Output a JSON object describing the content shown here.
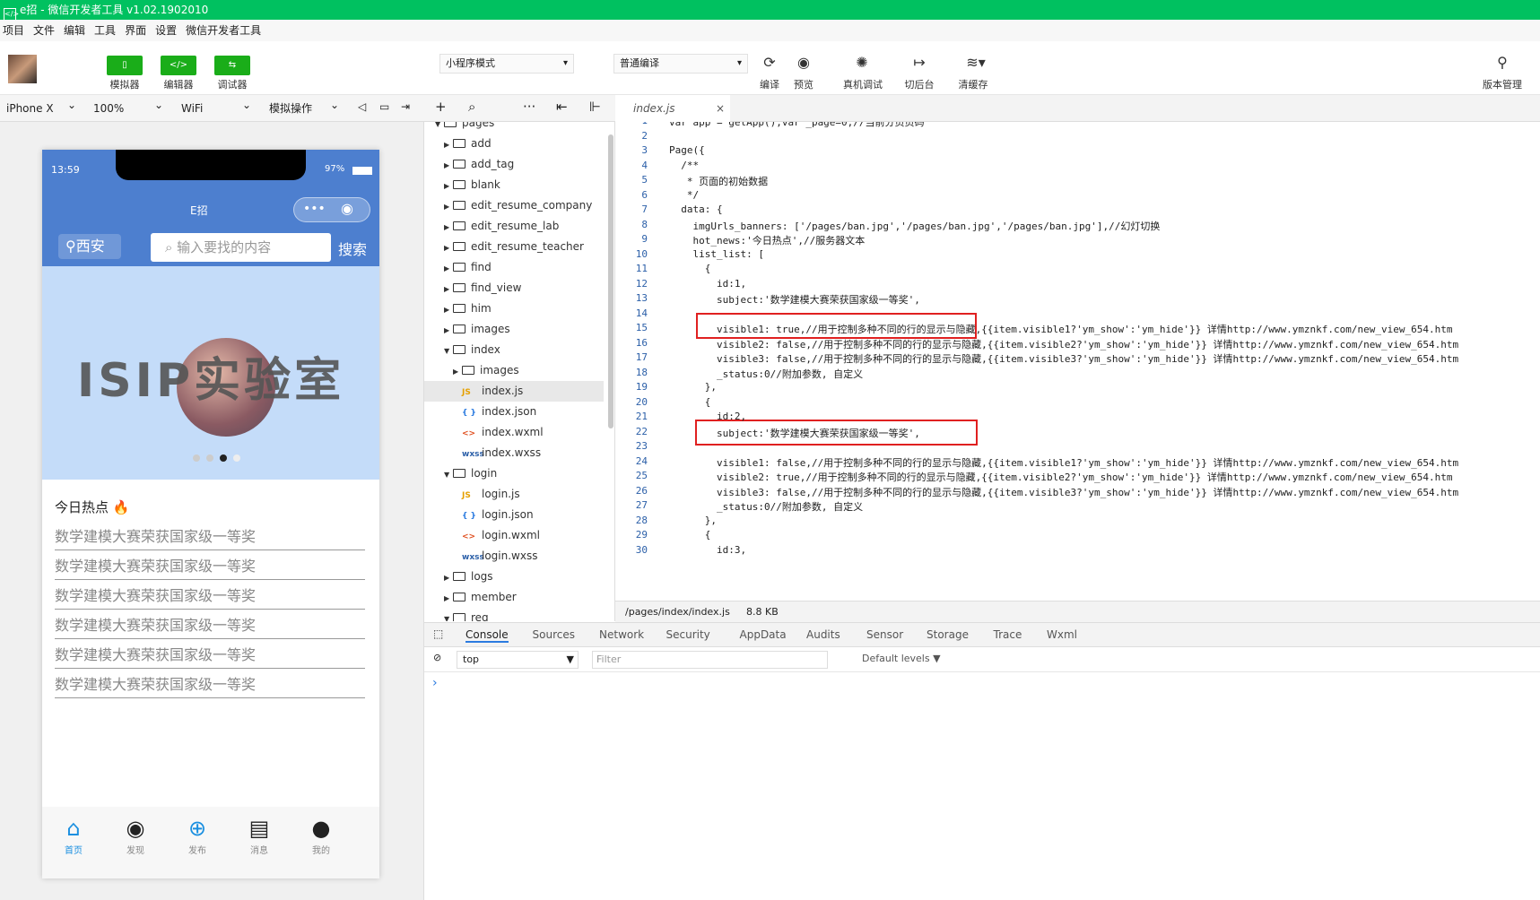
{
  "window": {
    "title": "e招 - 微信开发者工具 v1.02.1902010"
  },
  "menu": [
    "项目",
    "文件",
    "编辑",
    "工具",
    "界面",
    "设置",
    "微信开发者工具"
  ],
  "toolbar": {
    "simulator": "模拟器",
    "editor": "编辑器",
    "debugger": "调试器",
    "mode": "小程序模式",
    "compile_mode": "普通编译",
    "compile": "编译",
    "preview": "预览",
    "remote_debug": "真机调试",
    "background": "切后台",
    "clear_cache": "清缓存",
    "version": "版本管理"
  },
  "device": {
    "model": "iPhone X",
    "zoom": "100%",
    "network": "WiFi",
    "sim_ops": "模拟操作"
  },
  "phone": {
    "time": "13:59",
    "battery": "97%",
    "nav_title": "E招",
    "location": "西安",
    "search_placeholder": "输入要找的内容",
    "search_btn": "搜索",
    "banner_text": "ISIP实验室",
    "hot_title": "今日热点",
    "hot_items": [
      "数学建模大赛荣获国家级一等奖",
      "数学建模大赛荣获国家级一等奖",
      "数学建模大赛荣获国家级一等奖",
      "数学建模大赛荣获国家级一等奖",
      "数学建模大赛荣获国家级一等奖",
      "数学建模大赛荣获国家级一等奖"
    ],
    "tabs": [
      "首页",
      "发现",
      "发布",
      "消息",
      "我的"
    ]
  },
  "tree": [
    {
      "name": "pages",
      "type": "folder",
      "open": true,
      "level": 0
    },
    {
      "name": "add",
      "type": "folder",
      "level": 1
    },
    {
      "name": "add_tag",
      "type": "folder",
      "level": 1
    },
    {
      "name": "blank",
      "type": "folder",
      "level": 1
    },
    {
      "name": "edit_resume_company",
      "type": "folder",
      "level": 1
    },
    {
      "name": "edit_resume_lab",
      "type": "folder",
      "level": 1
    },
    {
      "name": "edit_resume_teacher",
      "type": "folder",
      "level": 1
    },
    {
      "name": "find",
      "type": "folder",
      "level": 1
    },
    {
      "name": "find_view",
      "type": "folder",
      "level": 1
    },
    {
      "name": "him",
      "type": "folder",
      "level": 1
    },
    {
      "name": "images",
      "type": "folder",
      "level": 1
    },
    {
      "name": "index",
      "type": "folder",
      "open": true,
      "level": 1
    },
    {
      "name": "images",
      "type": "folder",
      "level": 2
    },
    {
      "name": "index.js",
      "type": "js",
      "level": 2,
      "selected": true
    },
    {
      "name": "index.json",
      "type": "json",
      "level": 2
    },
    {
      "name": "index.wxml",
      "type": "wxml",
      "level": 2
    },
    {
      "name": "index.wxss",
      "type": "wxss",
      "level": 2
    },
    {
      "name": "login",
      "type": "folder",
      "open": true,
      "level": 1
    },
    {
      "name": "login.js",
      "type": "js",
      "level": 2
    },
    {
      "name": "login.json",
      "type": "json",
      "level": 2
    },
    {
      "name": "login.wxml",
      "type": "wxml",
      "level": 2
    },
    {
      "name": "login.wxss",
      "type": "wxss",
      "level": 2
    },
    {
      "name": "logs",
      "type": "folder",
      "level": 1
    },
    {
      "name": "member",
      "type": "folder",
      "level": 1
    },
    {
      "name": "reg",
      "type": "folder",
      "open": true,
      "level": 1
    }
  ],
  "file_icons": {
    "js": "JS",
    "json": "{ }",
    "wxml": "<>",
    "wxss": "wxss"
  },
  "editor": {
    "tab": "index.js",
    "lines": [
      "var app = getApp();var _page=0;//当前分页页码",
      "",
      "Page({",
      "  /**",
      "   * 页面的初始数据",
      "   */",
      "  data: {",
      "    imgUrls_banners: ['/pages/ban.jpg','/pages/ban.jpg','/pages/ban.jpg'],//幻灯切换",
      "    hot_news:'今日热点',//服务器文本",
      "    list_list: [",
      "      {",
      "        id:1,",
      "        subject:'数学建模大赛荣获国家级一等奖',",
      "",
      "        visible1: true,//用于控制多种不同的行的显示与隐藏,{{item.visible1?'ym_show':'ym_hide'}} 详情http://www.ymznkf.com/new_view_654.htm",
      "        visible2: false,//用于控制多种不同的行的显示与隐藏,{{item.visible2?'ym_show':'ym_hide'}} 详情http://www.ymznkf.com/new_view_654.htm",
      "        visible3: false,//用于控制多种不同的行的显示与隐藏,{{item.visible3?'ym_show':'ym_hide'}} 详情http://www.ymznkf.com/new_view_654.htm",
      "        _status:0//附加参数, 自定义",
      "      },",
      "      {",
      "        id:2,",
      "        subject:'数学建模大赛荣获国家级一等奖',",
      "",
      "        visible1: false,//用于控制多种不同的行的显示与隐藏,{{item.visible1?'ym_show':'ym_hide'}} 详情http://www.ymznkf.com/new_view_654.htm",
      "        visible2: true,//用于控制多种不同的行的显示与隐藏,{{item.visible2?'ym_show':'ym_hide'}} 详情http://www.ymznkf.com/new_view_654.htm",
      "        visible3: false,//用于控制多种不同的行的显示与隐藏,{{item.visible3?'ym_show':'ym_hide'}} 详情http://www.ymznkf.com/new_view_654.htm",
      "        _status:0//附加参数, 自定义",
      "      },",
      "      {",
      "        id:3,"
    ]
  },
  "status": {
    "path": "/pages/index/index.js",
    "size": "8.8 KB"
  },
  "devtools": {
    "tabs": [
      "Console",
      "Sources",
      "Network",
      "Security",
      "AppData",
      "Audits",
      "Sensor",
      "Storage",
      "Trace",
      "Wxml"
    ],
    "context": "top",
    "filter_placeholder": "Filter",
    "levels": "Default levels ▼",
    "prompt": "›"
  },
  "colors": {
    "title_green": "#00c160",
    "button_green": "#1aad19",
    "phone_header": "#4d7fcf",
    "tab_active": "#1a8fe0"
  }
}
